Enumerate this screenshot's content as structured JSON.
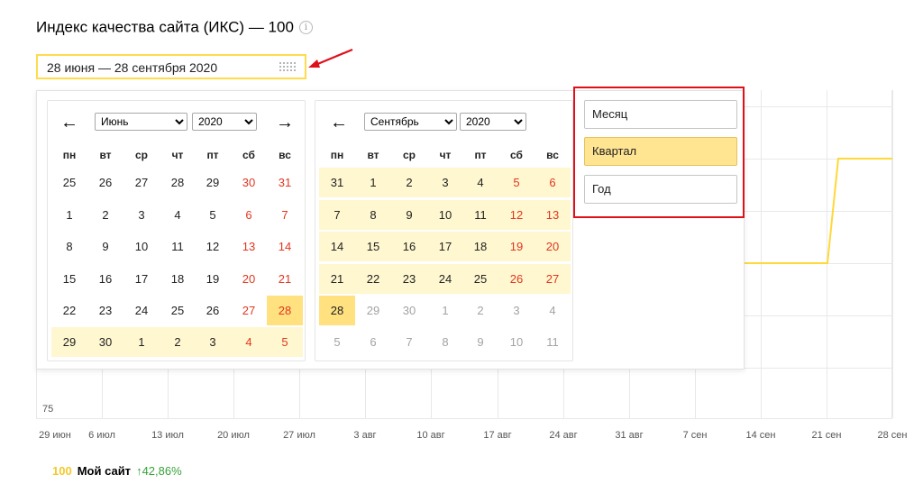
{
  "header": {
    "title": "Индекс качества сайта (ИКС) — 100",
    "info_icon": "info-icon"
  },
  "date_range": {
    "value": "28 июня — 28 сентября 2020",
    "icon": "calendar-grid-icon"
  },
  "weekdays": [
    "пн",
    "вт",
    "ср",
    "чт",
    "пт",
    "сб",
    "вс"
  ],
  "calendars": [
    {
      "prev_label": "←",
      "next_label": "→",
      "month": "Июнь",
      "year": "2020",
      "month_options": [
        "Июнь"
      ],
      "year_options": [
        "2020"
      ],
      "weeks": [
        [
          "25",
          "26",
          "27",
          "28",
          "29",
          "30",
          "31"
        ],
        [
          "1",
          "2",
          "3",
          "4",
          "5",
          "6",
          "7"
        ],
        [
          "8",
          "9",
          "10",
          "11",
          "12",
          "13",
          "14"
        ],
        [
          "15",
          "16",
          "17",
          "18",
          "19",
          "20",
          "21"
        ],
        [
          "22",
          "23",
          "24",
          "25",
          "26",
          "27",
          "28"
        ],
        [
          "29",
          "30",
          "1",
          "2",
          "3",
          "4",
          "5"
        ]
      ],
      "weeks_state": [
        [
          "n",
          "n",
          "n",
          "n",
          "n",
          "w",
          "w"
        ],
        [
          "n",
          "n",
          "n",
          "n",
          "n",
          "w",
          "w"
        ],
        [
          "n",
          "n",
          "n",
          "n",
          "n",
          "w",
          "w"
        ],
        [
          "n",
          "n",
          "n",
          "n",
          "n",
          "w",
          "w"
        ],
        [
          "n",
          "n",
          "n",
          "n",
          "n",
          "w",
          "we"
        ],
        [
          "r",
          "r",
          "r",
          "r",
          "r",
          "rw",
          "rw"
        ]
      ]
    },
    {
      "prev_label": "←",
      "month": "Сентябрь",
      "year": "2020",
      "month_options": [
        "Сентябрь"
      ],
      "year_options": [
        "2020"
      ],
      "weeks": [
        [
          "31",
          "1",
          "2",
          "3",
          "4",
          "5",
          "6"
        ],
        [
          "7",
          "8",
          "9",
          "10",
          "11",
          "12",
          "13"
        ],
        [
          "14",
          "15",
          "16",
          "17",
          "18",
          "19",
          "20"
        ],
        [
          "21",
          "22",
          "23",
          "24",
          "25",
          "26",
          "27"
        ],
        [
          "28",
          "29",
          "30",
          "1",
          "2",
          "3",
          "4"
        ],
        [
          "5",
          "6",
          "7",
          "8",
          "9",
          "10",
          "11"
        ]
      ],
      "weeks_state": [
        [
          "r",
          "r",
          "r",
          "r",
          "r",
          "rw",
          "rw"
        ],
        [
          "r",
          "r",
          "r",
          "r",
          "r",
          "rw",
          "rw"
        ],
        [
          "r",
          "r",
          "r",
          "r",
          "r",
          "rw",
          "rw"
        ],
        [
          "r",
          "r",
          "r",
          "r",
          "r",
          "rw",
          "rw"
        ],
        [
          "e",
          "m",
          "m",
          "m",
          "m",
          "m",
          "m"
        ],
        [
          "m",
          "m",
          "m",
          "m",
          "m",
          "m",
          "m"
        ]
      ]
    }
  ],
  "periods": [
    {
      "label": "Месяц",
      "active": false
    },
    {
      "label": "Квартал",
      "active": true
    },
    {
      "label": "Год",
      "active": false
    }
  ],
  "chart_data": {
    "type": "line",
    "y_axis_label_visible": "75",
    "x": [
      "29 июн",
      "6 июл",
      "13 июл",
      "20 июл",
      "27 июл",
      "3 авг",
      "10 авг",
      "17 авг",
      "24 авг",
      "31 авг",
      "7 сен",
      "14 сен",
      "21 сен",
      "28 сен"
    ],
    "series": [
      {
        "name": "Мой сайт",
        "color": "#ffd83a",
        "final_value": 100
      }
    ],
    "grid": true
  },
  "legend": {
    "value": "100",
    "name": "Мой сайт",
    "change": "↑42,86%"
  },
  "colors": {
    "accent_yellow": "#ffdb4d",
    "range_light": "#fff7d0",
    "range_edge": "#ffe180",
    "weekend_red": "#e0371f",
    "highlight_red": "#e0101a",
    "positive_green": "#37a33a"
  }
}
